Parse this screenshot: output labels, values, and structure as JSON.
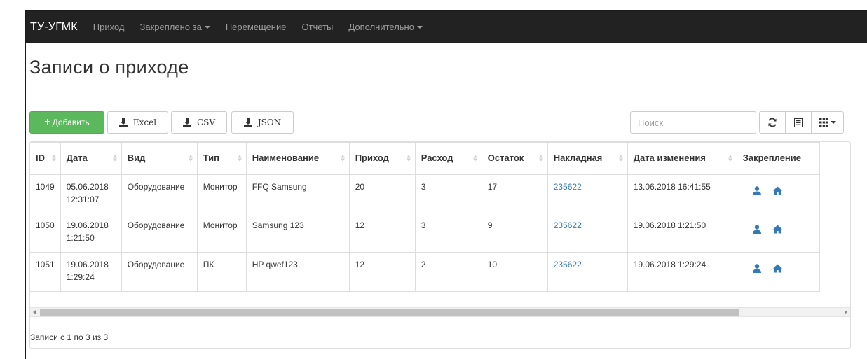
{
  "navbar": {
    "brand": "ТУ-УГМК",
    "items": [
      {
        "label": "Приход"
      },
      {
        "label": "Закреплено за"
      },
      {
        "label": "Перемещение"
      },
      {
        "label": "Отчеты"
      },
      {
        "label": "Дополнительно"
      }
    ]
  },
  "page": {
    "title": "Записи о приходе"
  },
  "toolbar": {
    "add_label": "Добавить",
    "add_color": "#5cb85c",
    "export_excel": "Excel",
    "export_csv": "CSV",
    "export_json": "JSON",
    "search_placeholder": "Поиск",
    "icons": [
      "refresh-icon",
      "list-toggle-icon",
      "columns-grid-icon"
    ]
  },
  "table": {
    "headers": [
      "ID",
      "Дата",
      "Вид",
      "Тип",
      "Наименование",
      "Приход",
      "Расход",
      "Остаток",
      "Накладная",
      "Дата изменения",
      "Закрепление"
    ],
    "rows": [
      {
        "id": "1049",
        "date": "05.06.2018",
        "time": "12:31:07",
        "kind": "Оборудование",
        "type": "Монитор",
        "name": "FFQ Samsung",
        "income": "20",
        "expense": "3",
        "balance": "17",
        "invoice": "235622",
        "modified": "13.06.2018 16:41:55"
      },
      {
        "id": "1050",
        "date": "19.06.2018",
        "time": "1:21:50",
        "kind": "Оборудование",
        "type": "Монитор",
        "name": "Samsung 123",
        "income": "12",
        "expense": "3",
        "balance": "9",
        "invoice": "235622",
        "modified": "19.06.2018 1:21:50"
      },
      {
        "id": "1051",
        "date": "19.06.2018",
        "time": "1:29:24",
        "kind": "Оборудование",
        "type": "ПК",
        "name": "HP qwef123",
        "income": "12",
        "expense": "2",
        "balance": "10",
        "invoice": "235622",
        "modified": "19.06.2018 1:29:24"
      }
    ],
    "link_color": "#337ab7",
    "row_icons": [
      "user-icon",
      "home-icon"
    ]
  },
  "pagination": {
    "info": "Записи с 1 по 3 из 3"
  }
}
